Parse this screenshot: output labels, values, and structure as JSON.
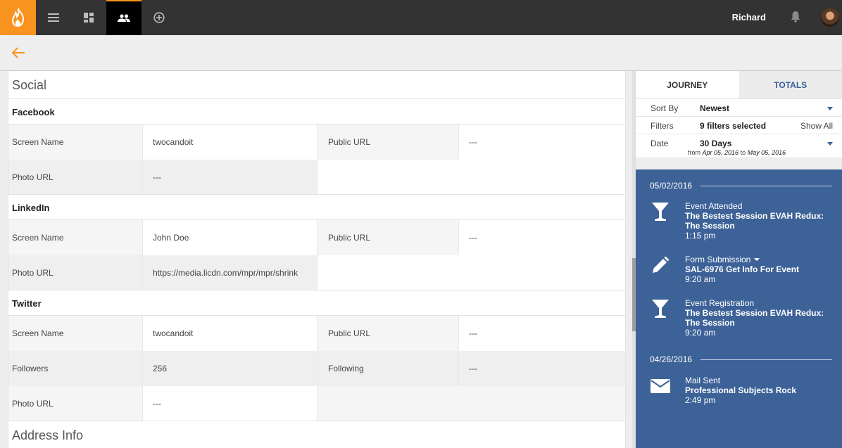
{
  "topbar": {
    "user_name": "Richard",
    "nav_icons": [
      "menu-icon",
      "dashboard-icon",
      "people-icon",
      "add-circle-icon"
    ],
    "accent": "#f7931e"
  },
  "main": {
    "sections": {
      "social": "Social",
      "address": "Address Info"
    },
    "facebook": {
      "title": "Facebook",
      "screen_name_label": "Screen Name",
      "screen_name": "twocandoit",
      "public_url_label": "Public URL",
      "public_url": "---",
      "photo_url_label": "Photo URL",
      "photo_url": "---"
    },
    "linkedin": {
      "title": "LinkedIn",
      "screen_name_label": "Screen Name",
      "screen_name": "John Doe",
      "public_url_label": "Public URL",
      "public_url": "---",
      "photo_url_label": "Photo URL",
      "photo_url": "https://media.licdn.com/mpr/mpr/shrink"
    },
    "twitter": {
      "title": "Twitter",
      "screen_name_label": "Screen Name",
      "screen_name": "twocandoit",
      "public_url_label": "Public URL",
      "public_url": "---",
      "followers_label": "Followers",
      "followers": "256",
      "following_label": "Following",
      "following": "---",
      "photo_url_label": "Photo URL",
      "photo_url": "---"
    }
  },
  "side": {
    "tabs": [
      "JOURNEY",
      "TOTALS"
    ],
    "sort_label": "Sort By",
    "sort_value": "Newest",
    "filters_label": "Filters",
    "filters_value": "9 filters selected",
    "show_all": "Show All",
    "date_label": "Date",
    "date_value": "30 Days",
    "date_from_word": "from",
    "date_from": "Apr 05, 2016",
    "date_to_word": "to",
    "date_to": "May 05, 2016",
    "timeline_color": "#3d6298",
    "groups": [
      {
        "date": "05/02/2016",
        "events": [
          {
            "icon": "cocktail-icon",
            "type": "Event Attended",
            "name": "The Bestest Session EVAH Redux: The Session",
            "time": "1:15 pm"
          },
          {
            "icon": "pencil-icon",
            "type": "Form Submission",
            "name": "SAL-6976 Get Info For Event",
            "time": "9:20 am"
          },
          {
            "icon": "cocktail-icon",
            "type": "Event Registration",
            "name": "The Bestest Session EVAH Redux: The Session",
            "time": "9:20 am"
          }
        ]
      },
      {
        "date": "04/26/2016",
        "events": [
          {
            "icon": "mail-icon",
            "type": "Mail Sent",
            "name": "Professional Subjects Rock",
            "time": "2:49 pm"
          }
        ]
      }
    ]
  }
}
